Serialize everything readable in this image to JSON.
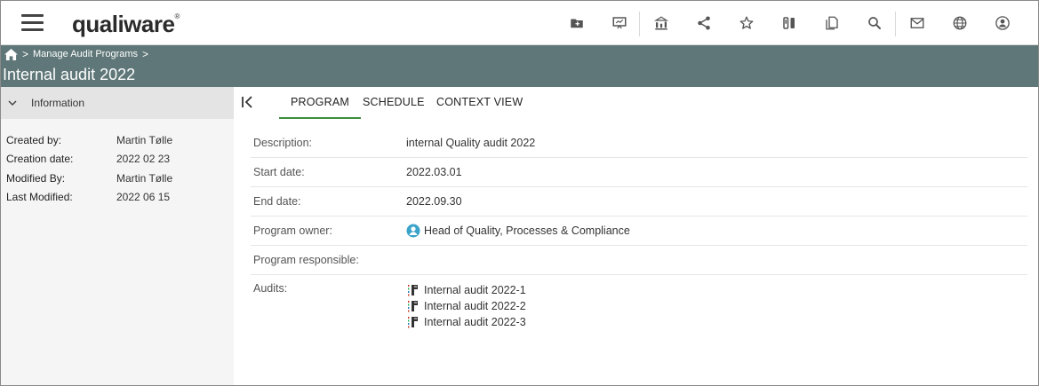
{
  "app": {
    "logo_text": "qualiware",
    "logo_mark": "®"
  },
  "toolbar": {
    "icons": [
      "folder-icon",
      "presentation-icon",
      "hierarchy-icon",
      "share-icon",
      "star-icon",
      "compare-icon",
      "copy-icon",
      "search-icon",
      "mail-icon",
      "globe-icon",
      "user-icon"
    ]
  },
  "breadcrumb": {
    "home_icon": "home-icon",
    "items": [
      "Manage Audit Programs"
    ],
    "separator": ">"
  },
  "page": {
    "title": "Internal audit 2022"
  },
  "info_panel": {
    "header": "Information",
    "rows": [
      {
        "label": "Created by:",
        "value": "Martin Tølle"
      },
      {
        "label": "Creation date:",
        "value": "2022 02 23"
      },
      {
        "label": "Modified By:",
        "value": "Martin Tølle"
      },
      {
        "label": "Last Modified:",
        "value": "2022 06 15"
      }
    ]
  },
  "tabs": [
    {
      "label": "PROGRAM",
      "active": true
    },
    {
      "label": "SCHEDULE",
      "active": false
    },
    {
      "label": "CONTEXT VIEW",
      "active": false
    }
  ],
  "program": {
    "description_label": "Description:",
    "description": "internal Quality audit 2022",
    "start_label": "Start date:",
    "start": "2022.03.01",
    "end_label": "End date:",
    "end": "2022.09.30",
    "owner_label": "Program owner:",
    "owner": "Head of Quality, Processes & Compliance",
    "responsible_label": "Program responsible:",
    "responsible": "",
    "audits_label": "Audits:",
    "audits": [
      "Internal audit 2022-1",
      "Internal audit 2022-2",
      "Internal audit 2022-3"
    ]
  },
  "colors": {
    "header_band": "#5f7778",
    "active_tab_underline": "#3b8e3b",
    "left_panel_bg": "#f5f5f5",
    "person_icon": "#3aa3c9"
  }
}
